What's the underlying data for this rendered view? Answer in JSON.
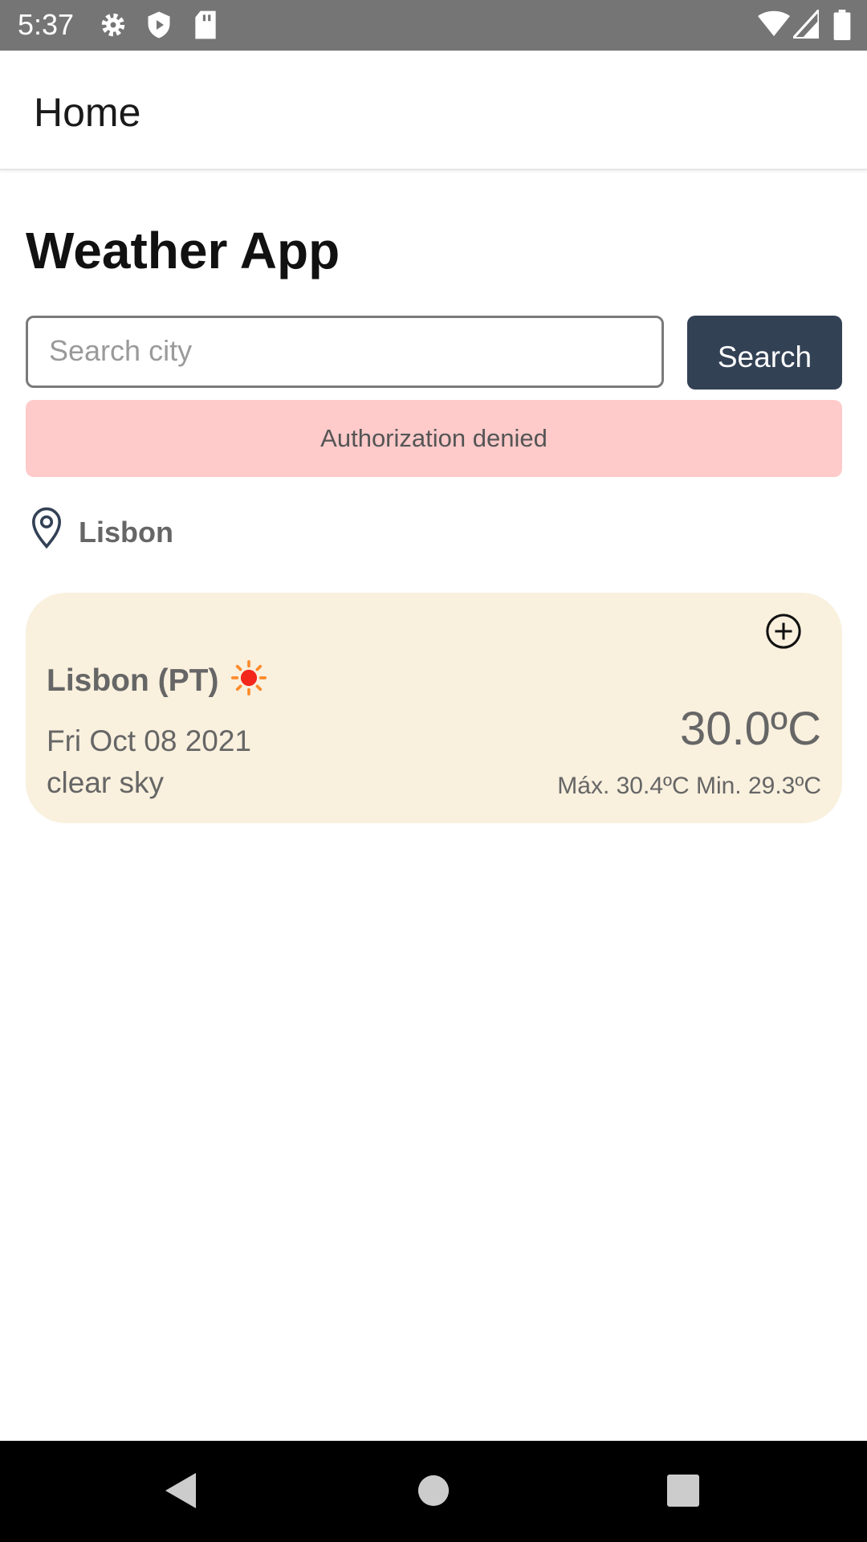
{
  "status_bar": {
    "time": "5:37",
    "icons": [
      "settings-icon",
      "shield-icon",
      "sd-card-icon",
      "wifi-icon",
      "signal-icon",
      "battery-icon"
    ]
  },
  "app_bar": {
    "title": "Home"
  },
  "main": {
    "title": "Weather App",
    "search": {
      "placeholder": "Search city",
      "value": "",
      "button_label": "Search"
    },
    "alert": {
      "message": "Authorization denied",
      "color": "#fecaca"
    },
    "current_location": {
      "icon": "location-pin-icon",
      "label": "Lisbon"
    },
    "weather_card": {
      "city": "Lisbon (PT)",
      "condition_icon": "sun-icon",
      "date": "Fri Oct 08 2021",
      "description": "clear sky",
      "temperature": "30.0ºC",
      "min_max": "Máx. 30.4ºC Min. 29.3ºC",
      "action_icon": "add-circle-icon",
      "background": "#f9f0de"
    }
  },
  "nav_bar": {
    "buttons": [
      "back-icon",
      "home-icon",
      "recents-icon"
    ]
  },
  "colors": {
    "accent": "#334155",
    "status_bar": "#757575"
  }
}
